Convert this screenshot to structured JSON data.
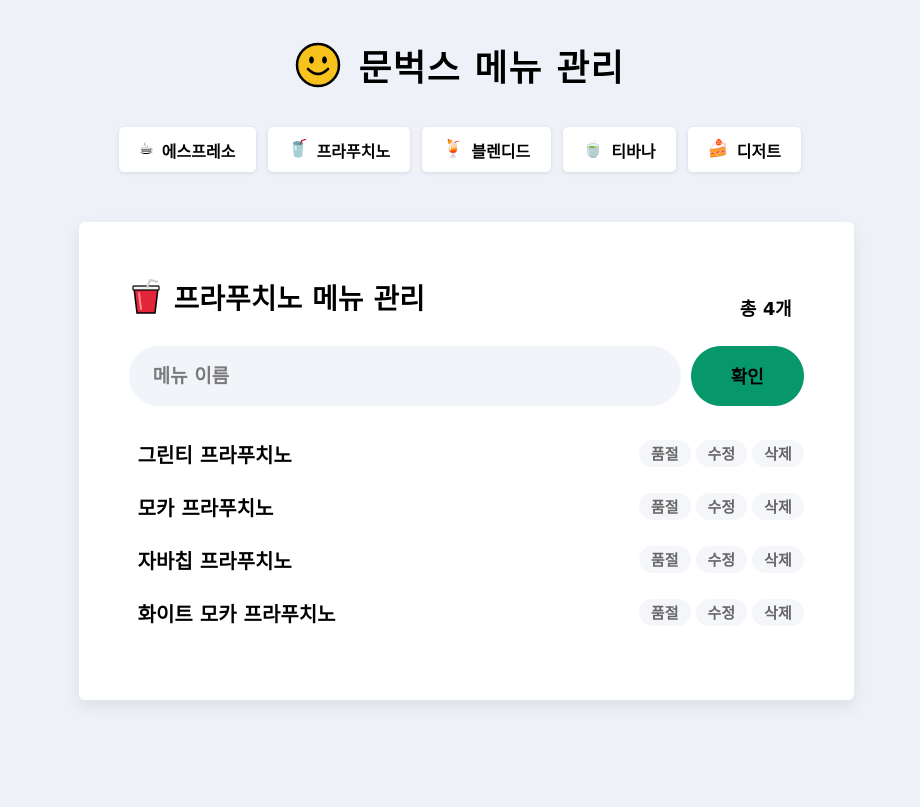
{
  "header": {
    "title": "문벅스 메뉴 관리",
    "icon": "smiley-face-icon"
  },
  "categories": [
    {
      "emoji": "☕",
      "label": "에스프레소",
      "icon": "coffee-icon"
    },
    {
      "emoji": "🥤",
      "label": "프라푸치노",
      "icon": "cup-with-straw-icon"
    },
    {
      "emoji": "🍹",
      "label": "블렌디드",
      "icon": "tropical-drink-icon"
    },
    {
      "emoji": "🍵",
      "label": "티바나",
      "icon": "tea-icon"
    },
    {
      "emoji": "🍰",
      "label": "디저트",
      "icon": "cake-icon"
    }
  ],
  "main": {
    "title": "프라푸치노 메뉴 관리",
    "title_icon": "cup-with-straw-icon",
    "count_text": "총 4개",
    "input": {
      "value": "",
      "placeholder": "메뉴 이름"
    },
    "submit_label": "확인",
    "items": [
      {
        "name": "그린티 프라푸치노",
        "soldout": "품절",
        "edit": "수정",
        "delete": "삭제"
      },
      {
        "name": "모카 프라푸치노",
        "soldout": "품절",
        "edit": "수정",
        "delete": "삭제"
      },
      {
        "name": "자바칩 프라푸치노",
        "soldout": "품절",
        "edit": "수정",
        "delete": "삭제"
      },
      {
        "name": "화이트 모카 프라푸치노",
        "soldout": "품절",
        "edit": "수정",
        "delete": "삭제"
      }
    ]
  },
  "colors": {
    "background": "#eef2f8",
    "accent": "#06976b",
    "card": "#ffffff"
  }
}
